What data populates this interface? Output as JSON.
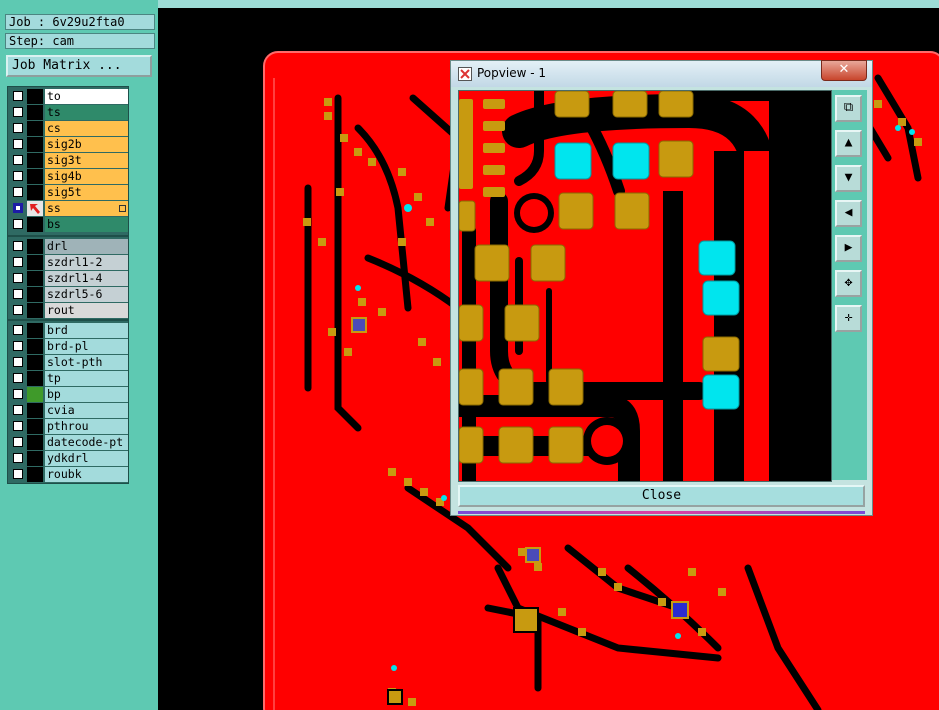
{
  "job": {
    "label": "Job : 6v29u2fta0",
    "step": "Step: cam"
  },
  "matrix_button": "Job Matrix ...",
  "layers_board": [
    {
      "name": "to",
      "bg": "#ffffff",
      "indicator": "#000000"
    },
    {
      "name": "ts",
      "bg": "#2f8a6a",
      "indicator": "#000000"
    },
    {
      "name": "cs",
      "bg": "#ffc04d",
      "indicator": "#000000"
    },
    {
      "name": "sig2b",
      "bg": "#ffc04d",
      "indicator": "#000000"
    },
    {
      "name": "sig3t",
      "bg": "#ffc04d",
      "indicator": "#000000"
    },
    {
      "name": "sig4b",
      "bg": "#ffc04d",
      "indicator": "#000000"
    },
    {
      "name": "sig5t",
      "bg": "#ffc04d",
      "indicator": "#000000"
    },
    {
      "name": "ss",
      "bg": "#ffc04d",
      "indicator": "#e6e6e6",
      "active": true
    },
    {
      "name": "bs",
      "bg": "#2f8a6a",
      "indicator": "#000000"
    }
  ],
  "layers_drill": [
    {
      "name": "drl",
      "bg": "#9fb3b8",
      "indicator": "#000000"
    },
    {
      "name": "szdrl1-2",
      "bg": "#c5d0d4",
      "indicator": "#000000"
    },
    {
      "name": "szdrl1-4",
      "bg": "#c5d0d4",
      "indicator": "#000000"
    },
    {
      "name": "szdrl5-6",
      "bg": "#c5d0d4",
      "indicator": "#000000"
    },
    {
      "name": "rout",
      "bg": "#d9d9d9",
      "indicator": "#000000"
    }
  ],
  "layers_misc": [
    {
      "name": "brd",
      "bg": "#a3dbdc",
      "indicator": "#000000"
    },
    {
      "name": "brd-pl",
      "bg": "#a3dbdc",
      "indicator": "#000000"
    },
    {
      "name": "slot-pth",
      "bg": "#a3dbdc",
      "indicator": "#000000"
    },
    {
      "name": "tp",
      "bg": "#a3dbdc",
      "indicator": "#000000"
    },
    {
      "name": "bp",
      "bg": "#a3dbdc",
      "indicator": "#3f9a2a"
    },
    {
      "name": "cvia",
      "bg": "#a3dbdc",
      "indicator": "#000000"
    },
    {
      "name": "pthrou",
      "bg": "#a3dbdc",
      "indicator": "#000000"
    },
    {
      "name": "datecode-pt",
      "bg": "#a3dbdc",
      "indicator": "#000000"
    },
    {
      "name": "ydkdrl",
      "bg": "#a3dbdc",
      "indicator": "#000000"
    },
    {
      "name": "roubk",
      "bg": "#a3dbdc",
      "indicator": "#000000"
    }
  ],
  "popup": {
    "title": "Popview - 1",
    "close_x": "✕",
    "close_label": "Close",
    "tools": [
      {
        "name": "zoom-fit-icon",
        "glyph": "⧉"
      },
      {
        "name": "pan-up-icon",
        "glyph": "▲"
      },
      {
        "name": "pan-down-icon",
        "glyph": "▼"
      },
      {
        "name": "pan-left-icon",
        "glyph": "◀"
      },
      {
        "name": "pan-right-icon",
        "glyph": "▶"
      },
      {
        "name": "zoom-out-icon",
        "glyph": "✥"
      },
      {
        "name": "zoom-in-icon",
        "glyph": "✛"
      }
    ]
  },
  "colors": {
    "copper": "#ff0000",
    "pad": "#c89a10",
    "via": "#00e5ee",
    "background": "#000000",
    "panel": "#5ec9b2"
  }
}
